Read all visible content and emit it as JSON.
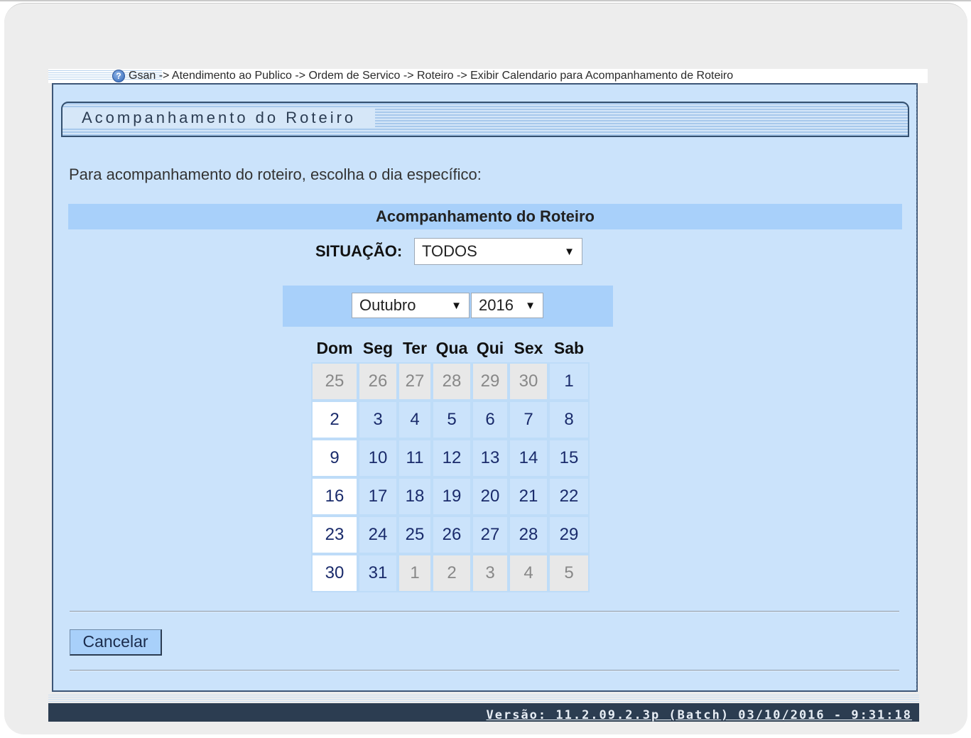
{
  "breadcrumb": {
    "text": "Gsan -> Atendimento ao Publico -> Ordem de Servico -> Roteiro -> Exibir Calendario para Acompanhamento de Roteiro"
  },
  "panel": {
    "title": "Acompanhamento do Roteiro",
    "instruction": "Para acompanhamento do roteiro, escolha o dia específico:",
    "section_header": "Acompanhamento do Roteiro"
  },
  "filter": {
    "situacao_label": "SITUAÇÃO:",
    "situacao_value": "TODOS"
  },
  "calendar": {
    "month": "Outubro",
    "year": "2016",
    "weekdays": [
      "Dom",
      "Seg",
      "Ter",
      "Qua",
      "Qui",
      "Sex",
      "Sab"
    ],
    "weeks": [
      [
        {
          "d": "25",
          "o": true
        },
        {
          "d": "26",
          "o": true
        },
        {
          "d": "27",
          "o": true
        },
        {
          "d": "28",
          "o": true
        },
        {
          "d": "29",
          "o": true
        },
        {
          "d": "30",
          "o": true
        },
        {
          "d": "1",
          "o": false
        }
      ],
      [
        {
          "d": "2",
          "o": false
        },
        {
          "d": "3",
          "o": false
        },
        {
          "d": "4",
          "o": false
        },
        {
          "d": "5",
          "o": false
        },
        {
          "d": "6",
          "o": false
        },
        {
          "d": "7",
          "o": false
        },
        {
          "d": "8",
          "o": false
        }
      ],
      [
        {
          "d": "9",
          "o": false
        },
        {
          "d": "10",
          "o": false
        },
        {
          "d": "11",
          "o": false
        },
        {
          "d": "12",
          "o": false
        },
        {
          "d": "13",
          "o": false
        },
        {
          "d": "14",
          "o": false
        },
        {
          "d": "15",
          "o": false
        }
      ],
      [
        {
          "d": "16",
          "o": false
        },
        {
          "d": "17",
          "o": false
        },
        {
          "d": "18",
          "o": false
        },
        {
          "d": "19",
          "o": false
        },
        {
          "d": "20",
          "o": false
        },
        {
          "d": "21",
          "o": false
        },
        {
          "d": "22",
          "o": false
        }
      ],
      [
        {
          "d": "23",
          "o": false
        },
        {
          "d": "24",
          "o": false
        },
        {
          "d": "25",
          "o": false
        },
        {
          "d": "26",
          "o": false
        },
        {
          "d": "27",
          "o": false
        },
        {
          "d": "28",
          "o": false
        },
        {
          "d": "29",
          "o": false
        }
      ],
      [
        {
          "d": "30",
          "o": false
        },
        {
          "d": "31",
          "o": false
        },
        {
          "d": "1",
          "o": true
        },
        {
          "d": "2",
          "o": true
        },
        {
          "d": "3",
          "o": true
        },
        {
          "d": "4",
          "o": true
        },
        {
          "d": "5",
          "o": true
        }
      ]
    ]
  },
  "actions": {
    "cancel_label": "Cancelar"
  },
  "footer": {
    "version": "Versão: 11.2.09.2.3p (Batch) 03/10/2016 - 9:31:18"
  },
  "colors": {
    "panel_bg": "#cbe3fb",
    "header_bg": "#a8d0fa",
    "footer_bg": "#2c3d51",
    "day_text": "#1a2b6b"
  },
  "icons": {
    "help": "help-icon",
    "dropdown": "dropdown-arrow-icon"
  }
}
